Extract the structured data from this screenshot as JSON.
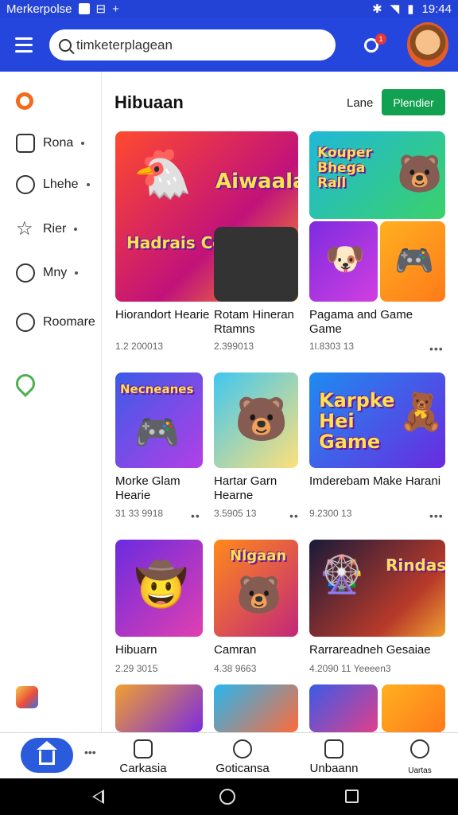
{
  "status_bar": {
    "carrier": "Merkerpolse",
    "time": "19:44"
  },
  "search": {
    "value": "timketerplagean",
    "placeholder": ""
  },
  "notification": {
    "count": "1"
  },
  "sidebar": {
    "items": [
      {
        "label": "Rona",
        "icon": "frame-icon"
      },
      {
        "label": "Lhehe",
        "icon": "instagram-icon"
      },
      {
        "label": "Rier",
        "icon": "star-icon"
      },
      {
        "label": "Mny",
        "icon": "chat-icon"
      },
      {
        "label": "Roomare",
        "icon": "person-icon"
      }
    ]
  },
  "main": {
    "title": "Hibuaan",
    "lane_label": "Lane",
    "action_button": "Plendier"
  },
  "games": [
    {
      "title": "Hiorandort Hearie",
      "meta": "1.2 200013",
      "more": "•••"
    },
    {
      "title": "Rotam Hineran Rtamns",
      "meta": "2.399013",
      "more": ""
    },
    {
      "title": "Pagama and Game Game",
      "meta": "1l.8303 13",
      "more": "•••"
    },
    {
      "title": "Morke Glam Hearie",
      "meta": "31 33 9918",
      "more": "••"
    },
    {
      "title": "Hartar Garn Hearne",
      "meta": "3.5905 13",
      "more": "••"
    },
    {
      "title": "Imderebam Make Harani",
      "meta": "9.2300 13",
      "more": "•••"
    },
    {
      "title": "Hibuarn",
      "meta": "2.29 3015",
      "more": ""
    },
    {
      "title": "Camran",
      "meta": "4.38 9663",
      "more": ""
    },
    {
      "title": "Rarrareadneh Gesaiae",
      "meta": "4.2090 11 Yeeeen3",
      "more": ""
    }
  ],
  "tiles": [
    {
      "text": "Aiwaala",
      "sub": "Hadrais Ceanns"
    },
    {
      "text": "Kouper Bhega Rall"
    },
    {
      "text": ""
    },
    {
      "text": "Necneanes"
    },
    {
      "text": ""
    },
    {
      "text": "Karpke Hei Game"
    },
    {
      "text": ""
    },
    {
      "text": "Nlgaan"
    },
    {
      "text": "Rindass"
    }
  ],
  "bottom_nav": [
    {
      "label": "Carkasia"
    },
    {
      "label": "Goticansa"
    },
    {
      "label": "Unbaann"
    },
    {
      "label": "Uartas"
    }
  ],
  "colors": {
    "primary": "#2446dc",
    "accent_green": "#12a150",
    "orange": "#f46b1e"
  }
}
